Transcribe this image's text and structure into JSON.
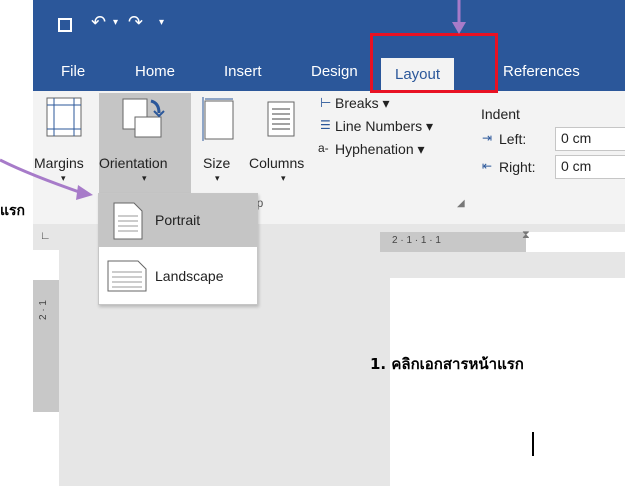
{
  "quick_access": {
    "save_icon": "save-icon",
    "undo_icon": "undo-icon",
    "redo_icon": "redo-icon",
    "customize_icon": "customize-icon"
  },
  "tabs": [
    "File",
    "Home",
    "Insert",
    "Design",
    "Layout",
    "References"
  ],
  "active_tab": "Layout",
  "ribbon": {
    "margins_label": "Margins",
    "orientation_label": "Orientation",
    "size_label": "Size",
    "columns_label": "Columns",
    "breaks_label": "Breaks",
    "line_numbers_label": "Line Numbers",
    "hyphenation_label": "Hyphenation",
    "indent_header": "Indent",
    "indent_left_label": "Left:",
    "indent_left_value": "0 cm",
    "indent_right_label": "Right:",
    "indent_right_value": "0 cm",
    "group_label_partial": "etup"
  },
  "orientation_menu": {
    "portrait_label": "Portrait",
    "landscape_label": "Landscape",
    "selected": "Portrait"
  },
  "ruler": {
    "horizontal": "2 · 1 · 1 · 1",
    "vertical": "2 · 1"
  },
  "annotations": {
    "left_partial": "แรก",
    "step1": "1. คลิกเอกสารหน้าแรก"
  },
  "colors": {
    "ribbon_blue": "#2b579a",
    "highlight_red": "#e81123",
    "arrow_purple": "#a77bc9"
  }
}
